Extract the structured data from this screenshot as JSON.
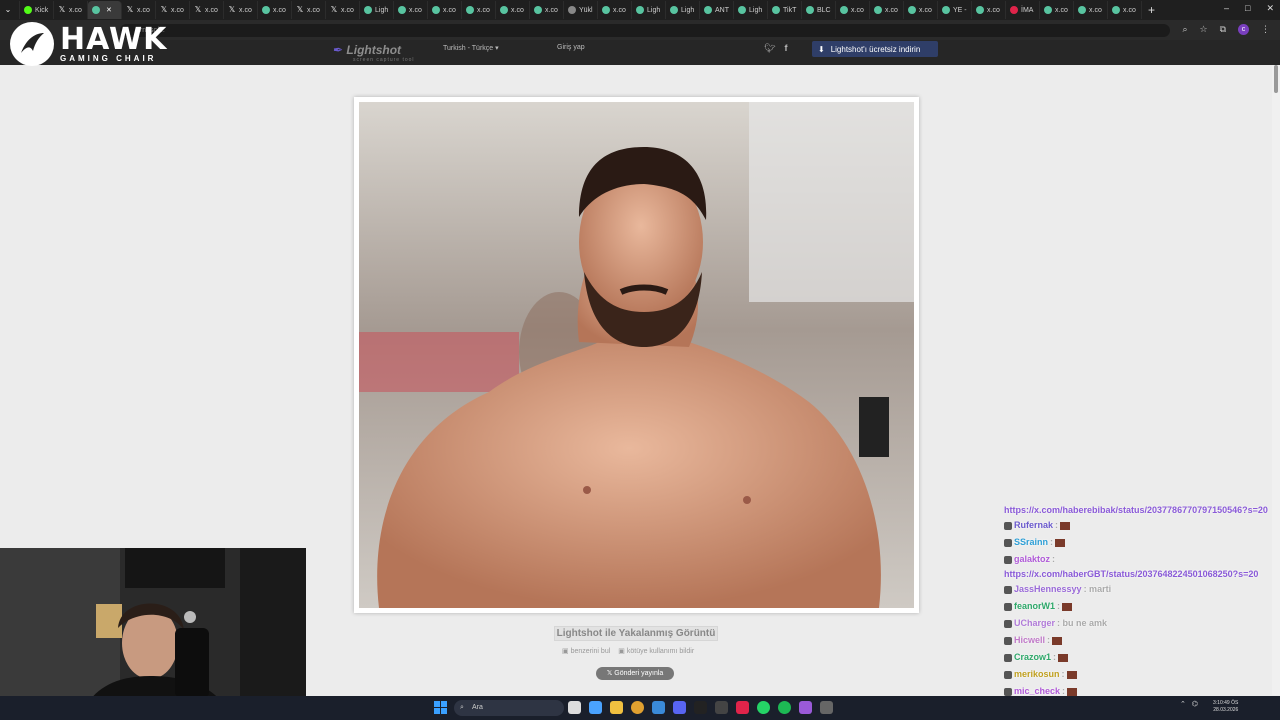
{
  "browser": {
    "tabs": [
      {
        "label": "Kick",
        "icon": "kick-icon",
        "active": false
      },
      {
        "label": "x.co",
        "icon": "x-icon",
        "active": false
      },
      {
        "label": "",
        "icon": "lightshot-icon",
        "active": true
      },
      {
        "label": "x.co",
        "icon": "x-icon",
        "active": false
      },
      {
        "label": "x.co",
        "icon": "x-icon",
        "active": false
      },
      {
        "label": "x.co",
        "icon": "x-icon",
        "active": false
      },
      {
        "label": "x.co",
        "icon": "x-icon",
        "active": false
      },
      {
        "label": "x.co",
        "icon": "lightshot-icon",
        "active": false
      },
      {
        "label": "x.co",
        "icon": "x-icon",
        "active": false
      },
      {
        "label": "x.co",
        "icon": "x-icon",
        "active": false
      },
      {
        "label": "Ligh",
        "icon": "lightshot-icon",
        "active": false
      },
      {
        "label": "x.co",
        "icon": "lightshot-icon",
        "active": false
      },
      {
        "label": "x.co",
        "icon": "lightshot-icon",
        "active": false
      },
      {
        "label": "x.co",
        "icon": "lightshot-icon",
        "active": false
      },
      {
        "label": "x.co",
        "icon": "lightshot-icon",
        "active": false
      },
      {
        "label": "x.co",
        "icon": "lightshot-icon",
        "active": false
      },
      {
        "label": "Yükl",
        "icon": "loading-icon",
        "active": false
      },
      {
        "label": "x.co",
        "icon": "lightshot-icon",
        "active": false
      },
      {
        "label": "Ligh",
        "icon": "lightshot-icon",
        "active": false
      },
      {
        "label": "Ligh",
        "icon": "lightshot-icon",
        "active": false
      },
      {
        "label": "ANT",
        "icon": "lightshot-icon",
        "active": false
      },
      {
        "label": "Ligh",
        "icon": "lightshot-icon",
        "active": false
      },
      {
        "label": "TikT",
        "icon": "lightshot-icon",
        "active": false
      },
      {
        "label": "BLC",
        "icon": "lightshot-icon",
        "active": false
      },
      {
        "label": "x.co",
        "icon": "lightshot-icon",
        "active": false
      },
      {
        "label": "x.co",
        "icon": "lightshot-icon",
        "active": false
      },
      {
        "label": "x.co",
        "icon": "lightshot-icon",
        "active": false
      },
      {
        "label": "YE -",
        "icon": "lightshot-icon",
        "active": false
      },
      {
        "label": "x.co",
        "icon": "lightshot-icon",
        "active": false
      },
      {
        "label": "İMA",
        "icon": "red-icon",
        "active": false
      },
      {
        "label": "x.co",
        "icon": "lightshot-icon",
        "active": false
      },
      {
        "label": "x.co",
        "icon": "lightshot-icon",
        "active": false
      },
      {
        "label": "x.co",
        "icon": "lightshot-icon",
        "active": false
      }
    ],
    "url": "prnt.sc/...",
    "new_tab": "+",
    "window_controls": [
      "–",
      "□",
      "✕"
    ]
  },
  "overlay": {
    "brand": "HAWK",
    "brand_sub": "GAMING CHAIR"
  },
  "lightshot": {
    "logo": "Lightshot",
    "logo_tagline": "screen capture tool",
    "language": "Turkish - Türkçe",
    "login": "Giriş yap",
    "download_button": "Lightshot'ı ücretsiz indirin",
    "caption": "Lightshot ile Yakalanmış Görüntü",
    "find_similar": "benzerini bul",
    "report_abuse": "kötüye kullanımı bildir",
    "post_button": "Gönderi yayınla"
  },
  "chat": {
    "messages": [
      {
        "user": "",
        "text": "https://x.com/haberebibak/status/2037786770797150546?s=20",
        "color": "#8a5ad8",
        "emote": false
      },
      {
        "user": "Rufernak",
        "text": " : ",
        "color": "#6a5acd",
        "emote": true
      },
      {
        "user": "SSrainn",
        "text": " : ",
        "color": "#2e9fd6",
        "emote": true
      },
      {
        "user": "galaktoz",
        "text": " :",
        "color": "#b05ad8",
        "emote": false
      },
      {
        "user": "",
        "text": "https://x.com/haberGBT/status/2037648224501068250?s=20",
        "color": "#8a5ad8",
        "emote": false
      },
      {
        "user": "JassHennessyy",
        "text": " : marti",
        "color": "#9a6ad8",
        "emote": false
      },
      {
        "user": "feanorW1",
        "text": " : ",
        "color": "#2ea86a",
        "emote": true
      },
      {
        "user": "UCharger",
        "text": " : bu ne amk",
        "color": "#b07ad8",
        "emote": false
      },
      {
        "user": "Hicwell",
        "text": " : ",
        "color": "#c07ac8",
        "emote": true
      },
      {
        "user": "Crazow1",
        "text": " : ",
        "color": "#2ea86a",
        "emote": true
      },
      {
        "user": "merikosun",
        "text": " : ",
        "color": "#c0a020",
        "emote": true
      },
      {
        "user": "mic_check",
        "text": " : ",
        "color": "#b05ad8",
        "emote": true
      }
    ]
  },
  "taskbar": {
    "search_placeholder": "Ara",
    "time": "3:10:49 ÖS",
    "date": "28.03.2026"
  },
  "colors": {
    "page_bg": "#ececec",
    "lightshot_header": "#262626",
    "download_button": "#2f3e68",
    "chat_link": "#8a5ad8"
  }
}
